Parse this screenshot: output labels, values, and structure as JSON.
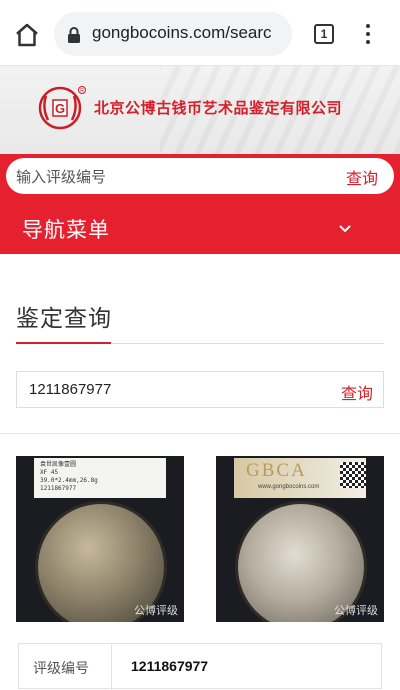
{
  "browser": {
    "url": "gongbocoins.com/searc",
    "tab_count": "1",
    "icons": [
      "home-icon",
      "lock-icon",
      "tabs-icon",
      "more-vert-icon"
    ]
  },
  "header": {
    "company_name": "北京公博古钱币艺术品鉴定有限公司",
    "logo_mark": "G",
    "brand_color": "#d4202a"
  },
  "top_search": {
    "placeholder": "输入评级编号",
    "button_label": "查询"
  },
  "nav": {
    "title": "导航菜单",
    "icon": "chevron-down-icon"
  },
  "main": {
    "section_title": "鉴定查询",
    "query_value": "1211867977",
    "query_button": "查询",
    "photos": [
      {
        "watermark": "公博评级",
        "label_lines": [
          "袁世凯像壹圆",
          "XF 45",
          "39.0*2.4mm,26.8g",
          "1211867977"
        ]
      },
      {
        "watermark": "公博评级",
        "brand": "GBCA",
        "brand_url": "www.gongbocoins.com"
      }
    ],
    "info": [
      {
        "key": "评级编号",
        "value": "1211867977"
      }
    ]
  }
}
